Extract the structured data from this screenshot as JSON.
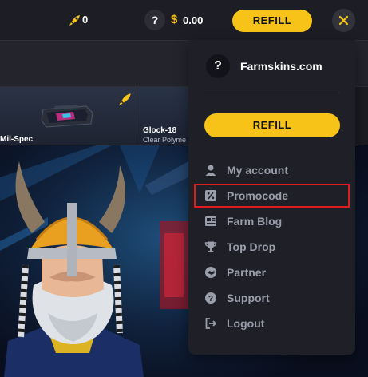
{
  "header": {
    "rocket_count": "0",
    "help_symbol": "?",
    "currency_symbol": "$",
    "balance": "0.00",
    "refill_label": "REFILL",
    "close_icon": "close-icon",
    "accent_color": "#f7c318"
  },
  "live_drops": {
    "items": [
      {
        "name": "Mil-Spec"
      },
      {
        "name": "Glock-18",
        "subtitle": "Clear Polyme"
      }
    ]
  },
  "menu": {
    "help_symbol": "?",
    "site_name": "Farmskins.com",
    "refill_label": "REFILL",
    "items": [
      {
        "label": "My account",
        "icon": "user-icon"
      },
      {
        "label": "Promocode",
        "icon": "percent-icon"
      },
      {
        "label": "Farm Blog",
        "icon": "news-icon"
      },
      {
        "label": "Top Drop",
        "icon": "trophy-icon"
      },
      {
        "label": "Partner",
        "icon": "handshake-icon"
      },
      {
        "label": "Support",
        "icon": "support-icon"
      },
      {
        "label": "Logout",
        "icon": "logout-icon"
      }
    ],
    "highlighted_item": "Promocode",
    "highlight_color": "#e01b1b"
  }
}
